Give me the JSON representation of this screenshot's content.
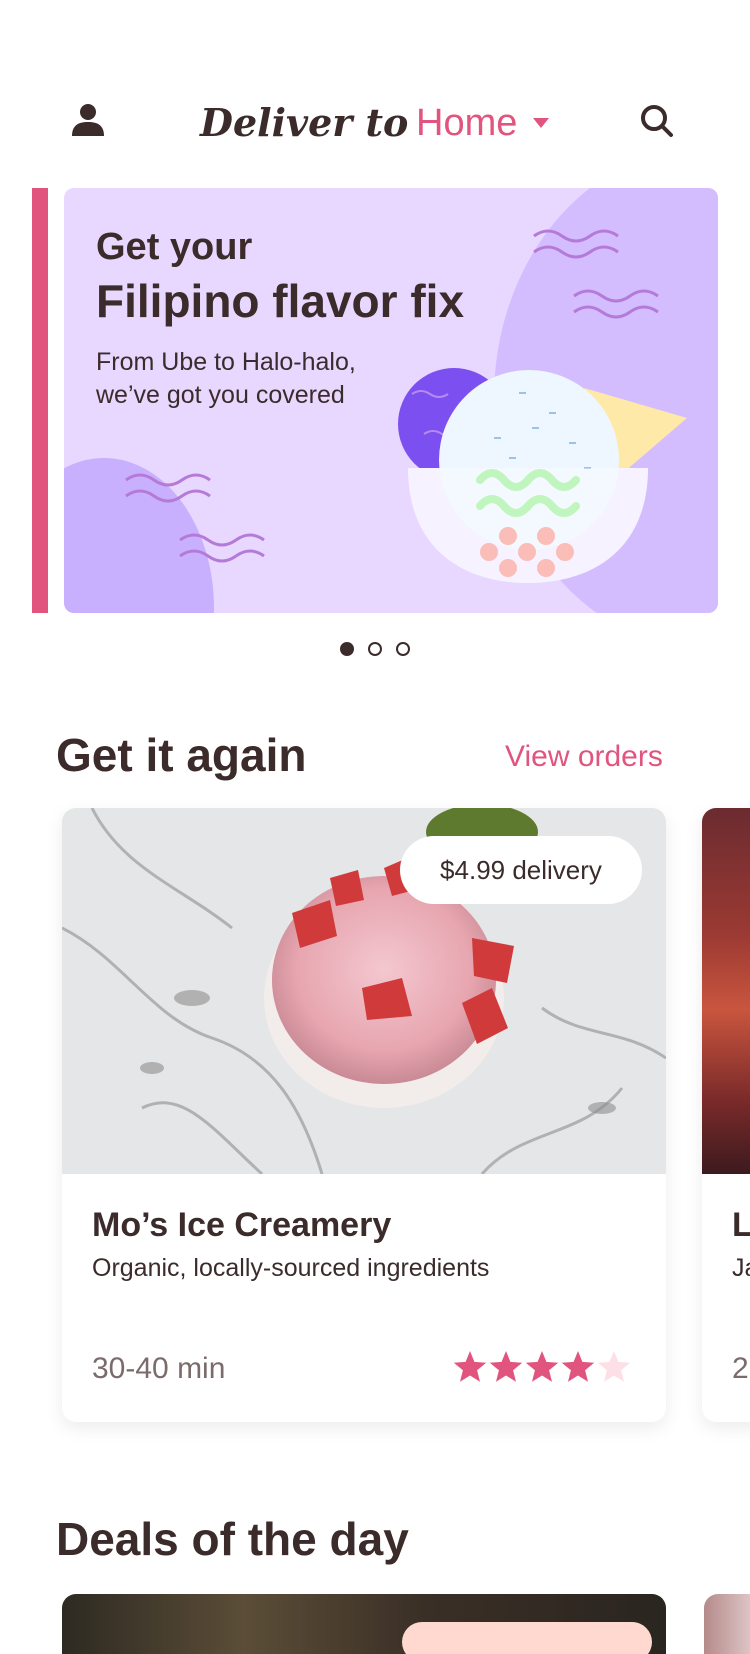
{
  "header": {
    "deliver_label": "Deliver to",
    "location": "Home"
  },
  "banner": {
    "kicker": "Get your",
    "title": "Filipino flavor fix",
    "subtitle": "From Ube to Halo-halo, we’ve got you covered",
    "carousel": {
      "pages": 3,
      "active_index": 0
    }
  },
  "get_it_again": {
    "title": "Get it again",
    "link": "View orders",
    "cards": [
      {
        "delivery_badge": "$4.99 delivery",
        "name": "Mo’s Ice Creamery",
        "description": "Organic, locally-sourced ingredients",
        "time": "30-40 min",
        "rating": 4,
        "rating_max": 5
      },
      {
        "name": "L",
        "description": "Ja",
        "time": "2"
      }
    ]
  },
  "deals": {
    "title": "Deals of the day"
  },
  "colors": {
    "accent": "#e1547e",
    "text": "#3b2b2b",
    "banner_bg": "#e8d8ff",
    "star_off": "#fde0e6"
  }
}
